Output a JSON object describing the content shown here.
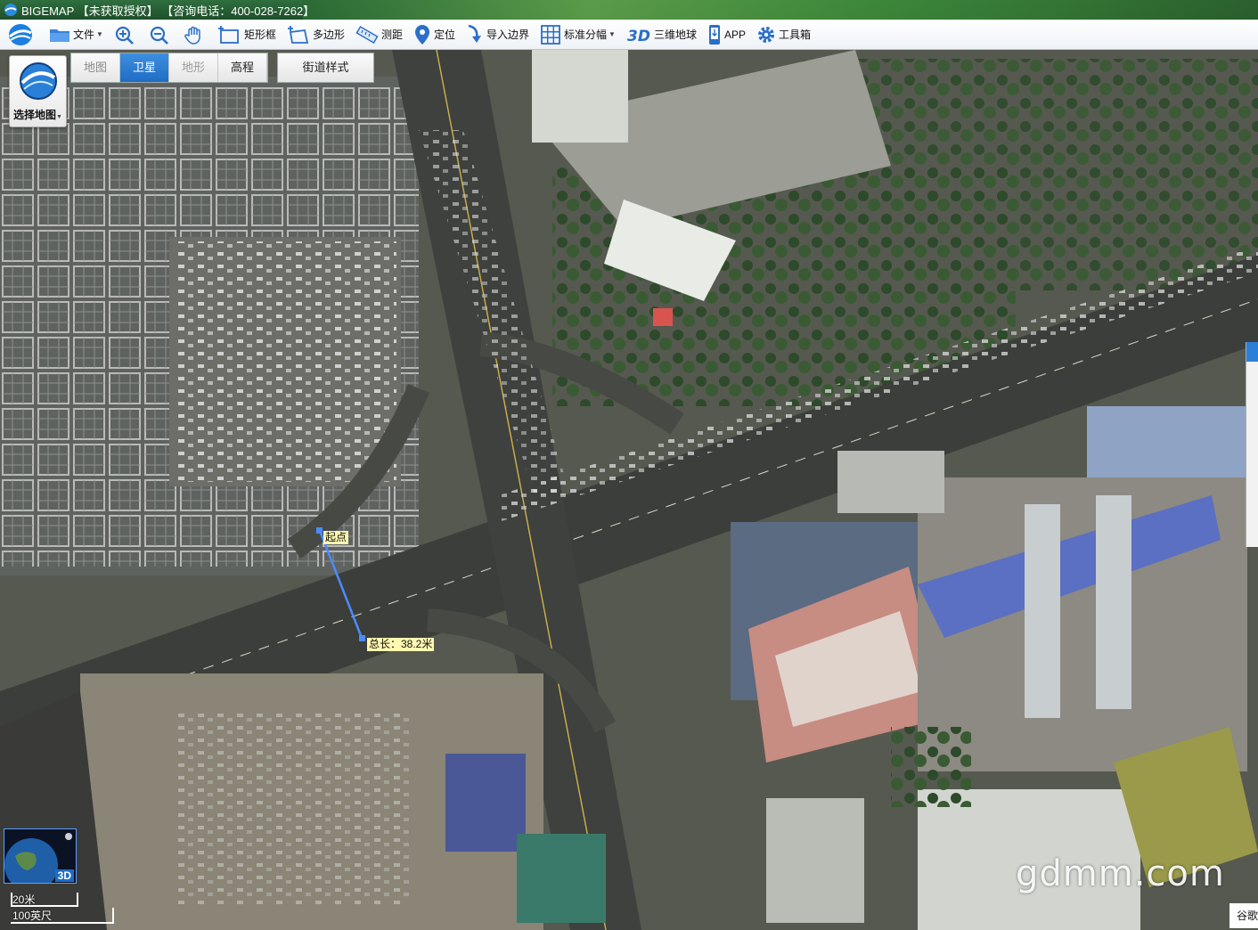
{
  "titlebar": {
    "text": "BIGEMAP 【未获取授权】 【咨询电话：400-028-7262】"
  },
  "toolbar": {
    "items": [
      {
        "label": "文件",
        "icon": "folder-icon",
        "dropdown": true
      },
      {
        "label": "",
        "icon": "zoom-in-icon"
      },
      {
        "label": "",
        "icon": "zoom-out-icon"
      },
      {
        "label": "",
        "icon": "hand-pan-icon"
      },
      {
        "label": "矩形框",
        "icon": "rectangle-select-icon"
      },
      {
        "label": "多边形",
        "icon": "polygon-icon"
      },
      {
        "label": "测距",
        "icon": "ruler-icon"
      },
      {
        "label": "定位",
        "icon": "location-pin-icon"
      },
      {
        "label": "导入边界",
        "icon": "import-boundary-icon"
      },
      {
        "label": "标准分幅",
        "icon": "grid-icon",
        "dropdown": true
      },
      {
        "label": "三维地球",
        "icon": "3d-icon"
      },
      {
        "label": "APP",
        "icon": "phone-icon"
      },
      {
        "label": "工具箱",
        "icon": "gear-icon"
      }
    ]
  },
  "map_selector": {
    "label": "选择地图"
  },
  "map_tabs": [
    {
      "label": "地图",
      "state": "normal"
    },
    {
      "label": "卫星",
      "state": "active"
    },
    {
      "label": "地形",
      "state": "disabled"
    },
    {
      "label": "高程",
      "state": "normal"
    }
  ],
  "street_style": {
    "label": "街道样式"
  },
  "measure": {
    "start_label": "起点",
    "total_label": "总长：38.2米"
  },
  "mini3d": {
    "label": "3D"
  },
  "scale": {
    "metric": "20米",
    "imperial": "100英尺"
  },
  "watermark": "gdmm.com",
  "provider": "谷歌",
  "colors": {
    "accent": "#1f6cc4",
    "measure_line": "#4a8cff"
  }
}
